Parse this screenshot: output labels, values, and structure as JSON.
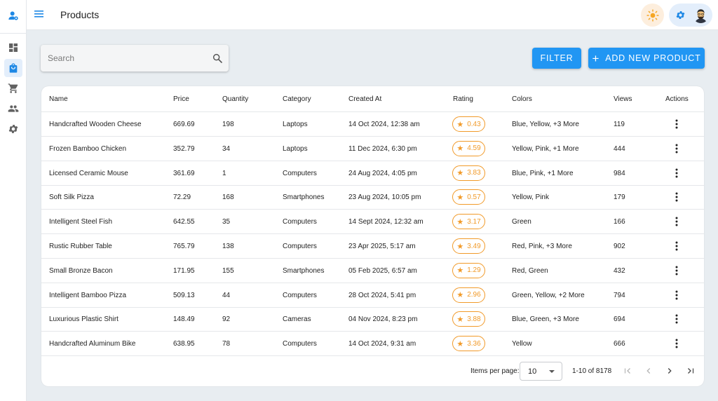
{
  "header": {
    "title": "Products"
  },
  "search": {
    "placeholder": "Search"
  },
  "actions": {
    "filter_label": "FILTER",
    "add_plus": "+",
    "add_label": "ADD NEW PRODUCT"
  },
  "table": {
    "columns": [
      "Name",
      "Price",
      "Quantity",
      "Category",
      "Created At",
      "Rating",
      "Colors",
      "Views",
      "Actions"
    ],
    "rows": [
      {
        "name": "Handcrafted Wooden Cheese",
        "price": "669.69",
        "quantity": "198",
        "category": "Laptops",
        "created_at": "14 Oct 2024, 12:38 am",
        "rating": "0.43",
        "colors": "Blue, Yellow, +3 More",
        "views": "119"
      },
      {
        "name": "Frozen Bamboo Chicken",
        "price": "352.79",
        "quantity": "34",
        "category": "Laptops",
        "created_at": "11 Dec 2024, 6:30 pm",
        "rating": "4.59",
        "colors": "Yellow, Pink, +1 More",
        "views": "444"
      },
      {
        "name": "Licensed Ceramic Mouse",
        "price": "361.69",
        "quantity": "1",
        "category": "Computers",
        "created_at": "24 Aug 2024, 4:05 pm",
        "rating": "3.83",
        "colors": "Blue, Pink, +1 More",
        "views": "984"
      },
      {
        "name": "Soft Silk Pizza",
        "price": "72.29",
        "quantity": "168",
        "category": "Smartphones",
        "created_at": "23 Aug 2024, 10:05 pm",
        "rating": "0.57",
        "colors": "Yellow, Pink",
        "views": "179"
      },
      {
        "name": "Intelligent Steel Fish",
        "price": "642.55",
        "quantity": "35",
        "category": "Computers",
        "created_at": "14 Sept 2024, 12:32 am",
        "rating": "3.17",
        "colors": "Green",
        "views": "166"
      },
      {
        "name": "Rustic Rubber Table",
        "price": "765.79",
        "quantity": "138",
        "category": "Computers",
        "created_at": "23 Apr 2025, 5:17 am",
        "rating": "3.49",
        "colors": "Red, Pink, +3 More",
        "views": "902"
      },
      {
        "name": "Small Bronze Bacon",
        "price": "171.95",
        "quantity": "155",
        "category": "Smartphones",
        "created_at": "05 Feb 2025, 6:57 am",
        "rating": "1.29",
        "colors": "Red, Green",
        "views": "432"
      },
      {
        "name": "Intelligent Bamboo Pizza",
        "price": "509.13",
        "quantity": "44",
        "category": "Computers",
        "created_at": "28 Oct 2024, 5:41 pm",
        "rating": "2.96",
        "colors": "Green, Yellow, +2 More",
        "views": "794"
      },
      {
        "name": "Luxurious Plastic Shirt",
        "price": "148.49",
        "quantity": "92",
        "category": "Cameras",
        "created_at": "04 Nov 2024, 8:23 pm",
        "rating": "3.88",
        "colors": "Blue, Green, +3 More",
        "views": "694"
      },
      {
        "name": "Handcrafted Aluminum Bike",
        "price": "638.95",
        "quantity": "78",
        "category": "Computers",
        "created_at": "14 Oct 2024, 9:31 am",
        "rating": "3.36",
        "colors": "Yellow",
        "views": "666"
      }
    ]
  },
  "pagination": {
    "items_per_page_label": "Items per page:",
    "items_per_page_value": "10",
    "range": "1-10 of 8178"
  },
  "icons": {
    "sidebar": [
      "account-circle-icon",
      "dashboard-icon",
      "shopping-bag-icon",
      "cart-icon",
      "people-icon",
      "settings-icon"
    ],
    "rating": "star-icon"
  },
  "colors": {
    "accent": "#2196f3",
    "rating": "#f19a29",
    "sun": "#f5a623",
    "background": "#e8edf1"
  }
}
